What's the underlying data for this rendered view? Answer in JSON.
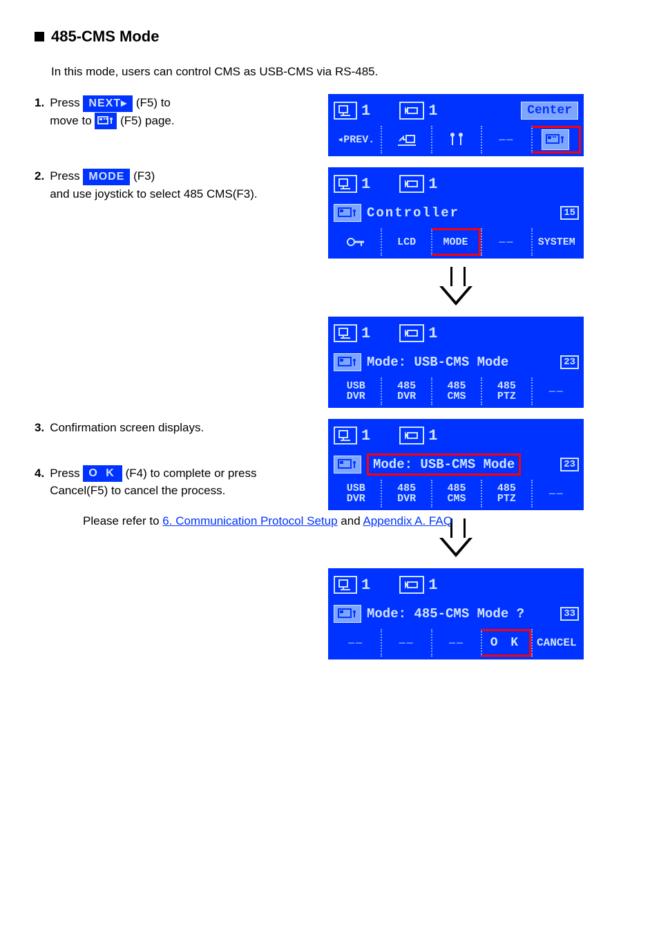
{
  "section_title": "485-CMS Mode",
  "intro": "In this mode, users can control CMS as USB-CMS via RS-485.",
  "steps": {
    "s1a": "Press",
    "s1b": "(F5) to",
    "s1c": "move to",
    "s1d": "(F5)",
    "s1e": "page.",
    "s2a": "Press",
    "s2b": "(F3)",
    "s2c": "and use joystick to select 485 CMS(F3).",
    "s3": "Confirmation screen displays.",
    "s4a": "Press",
    "s4b": "(F4) to complete or press Cancel(F5) to cancel the process.",
    "s5a": "Please refer to",
    "s5b": "6. Communication Protocol Setup",
    "s5c": "and",
    "s5d": "Appendix A. FAQ"
  },
  "chips": {
    "next": "NEXT▸",
    "mode": "MODE",
    "ok": "O K"
  },
  "lcd1": {
    "dvr_num": "1",
    "cam_num": "1",
    "center": "Center",
    "prev": "◂PREV."
  },
  "lcd2": {
    "dvr_num": "1",
    "cam_num": "1",
    "title": "Controller",
    "badge": "15",
    "f2": "LCD",
    "f3": "MODE",
    "f5": "SYSTEM"
  },
  "lcd3": {
    "dvr_num": "1",
    "cam_num": "1",
    "title": "Mode: USB-CMS Mode",
    "badge": "23",
    "f1a": "USB",
    "f1b": "DVR",
    "f2a": "485",
    "f2b": "DVR",
    "f3a": "485",
    "f3b": "CMS",
    "f4a": "485",
    "f4b": "PTZ"
  },
  "lcd4": {
    "dvr_num": "1",
    "cam_num": "1",
    "title": "Mode: USB-CMS Mode",
    "badge": "23",
    "f1a": "USB",
    "f1b": "DVR",
    "f2a": "485",
    "f2b": "DVR",
    "f3a": "485",
    "f3b": "CMS",
    "f4a": "485",
    "f4b": "PTZ"
  },
  "lcd5": {
    "dvr_num": "1",
    "cam_num": "1",
    "title": "Mode: 485-CMS Mode ?",
    "badge": "33",
    "f4": "O K",
    "f5": "CANCEL"
  }
}
